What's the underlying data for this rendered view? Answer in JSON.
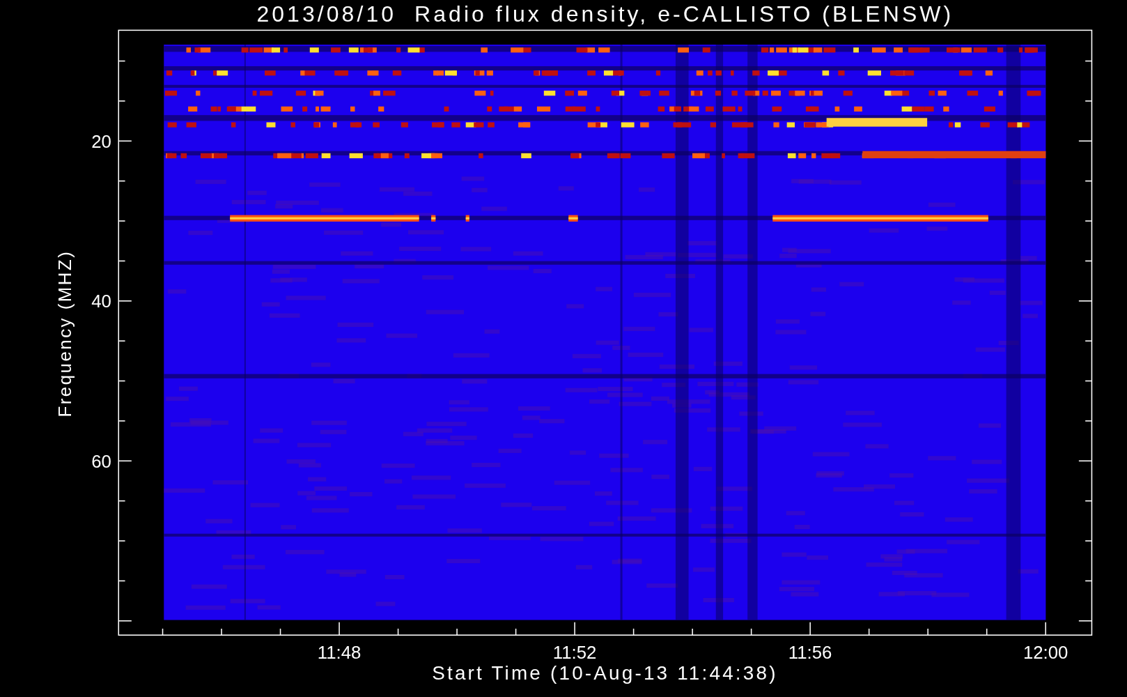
{
  "title": "2013/08/10  Radio flux density, e-CALLISTO (BLENSW)",
  "y_axis": {
    "label": "Frequency (MHZ)",
    "ticks": [
      "20",
      "40",
      "60"
    ]
  },
  "x_axis": {
    "label": "Start Time (10-Aug-13 11:44:38)",
    "ticks": [
      "11:48",
      "11:52",
      "11:56",
      "12:00"
    ]
  }
}
